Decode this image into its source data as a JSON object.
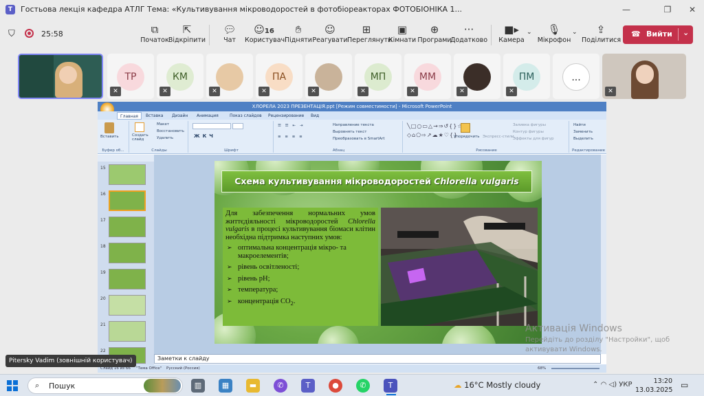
{
  "window": {
    "title": "Гостьова лекція кафедра АТЛГ Тема: «Культивування мікроводоростей в фотобіореакторах ФОТОБІОНІКА 1..."
  },
  "toolbar": {
    "timer": "25:58",
    "items": [
      {
        "label": "Початок",
        "icon": "share-screen-icon"
      },
      {
        "label": "Відкріпити",
        "icon": "unpin-icon"
      },
      {
        "label": "Чат",
        "icon": "chat-icon"
      },
      {
        "label": "Користувачі",
        "icon": "people-icon",
        "count": "16"
      },
      {
        "label": "Підняти",
        "icon": "raise-hand-icon"
      },
      {
        "label": "Реагувати",
        "icon": "react-icon"
      },
      {
        "label": "Переглянути",
        "icon": "view-icon"
      },
      {
        "label": "Кімнати",
        "icon": "rooms-icon"
      },
      {
        "label": "Програми",
        "icon": "apps-icon"
      },
      {
        "label": "Додатково",
        "icon": "more-icon"
      }
    ],
    "camera": "Камера",
    "mic": "Мікрофон",
    "share": "Поділитися",
    "leave": "Вийти"
  },
  "participants": [
    {
      "initials": "ТР"
    },
    {
      "initials": "КМ"
    },
    {
      "initials": "ПА"
    },
    {
      "initials": "МП"
    },
    {
      "initials": "ММ"
    },
    {
      "initials": "ПМ"
    },
    {
      "initials": "..."
    }
  ],
  "powerpoint": {
    "title": "ХЛОРЕЛА 2023 ПРЕЗЕНТАЦІЯ.ppt [Режим совместимости] - Microsoft PowerPoint",
    "tabs": [
      "Главная",
      "Вставка",
      "Дизайн",
      "Анимация",
      "Показ слайдов",
      "Рецензирование",
      "Вид"
    ],
    "groups": [
      "Буфер об...",
      "Слайды",
      "Шрифт",
      "Абзац",
      "Рисование",
      "Редактирование"
    ],
    "ribbon_text": {
      "paste": "Вставить",
      "create": "Создать слайд",
      "layout": "Макет",
      "restore": "Восстановить",
      "delete": "Удалить",
      "direction": "Направление текста",
      "align": "Выровнять текст",
      "smartart": "Преобразовать в SmartArt",
      "arrange": "Упорядочить",
      "styles": "Экспресс-стили",
      "fill": "Заливка фигуры",
      "outline": "Контур фигуры",
      "effects": "Эффекты для фигур",
      "find": "Найти",
      "replace": "Заменить",
      "select": "Выделить"
    },
    "thumbnails": [
      "15",
      "16",
      "17",
      "18",
      "19",
      "20",
      "21",
      "22"
    ],
    "notes": "Заметки к слайду",
    "status": {
      "slide": "Слайд 16 из 66",
      "theme": "\"Тема Office\"",
      "lang": "Русский (Россия)",
      "zoom": "68%"
    }
  },
  "slide": {
    "title_prefix": "Схема культивування мікроводоростей ",
    "title_italic": "Chlorella vulgaris",
    "intro_a": "Для забезпечення нормальних умов життєдіяльності мікроводоростей ",
    "intro_italic": "Chlorella vulgaris",
    "intro_b": " в процесі культивування біомаси клітин необхідна підтримка наступних умов:",
    "bullets": [
      "оптимальна концентрація мікро- та макроелементів;",
      "рівень освітленості;",
      "рівень pH;",
      "температура;"
    ],
    "co2_prefix": "концентрація CO",
    "co2_sub": "2",
    "co2_suffix": "."
  },
  "watermark": {
    "title": "Активація Windows",
    "subtitle": "Перейдіть до розділу \"Настройки\", щоб активувати Windows."
  },
  "presenter_chip": "Pitersky Vadim (зовнішній користувач)",
  "taskbar": {
    "search": "Пошук",
    "weather": "16°C  Mostly cloudy",
    "lang": "УКР",
    "time": "13:20",
    "date": "13.03.2025"
  },
  "colors": {
    "leave": "#c4314b",
    "teams": "#5b5fc7",
    "slide_green": "#7dbb39"
  }
}
